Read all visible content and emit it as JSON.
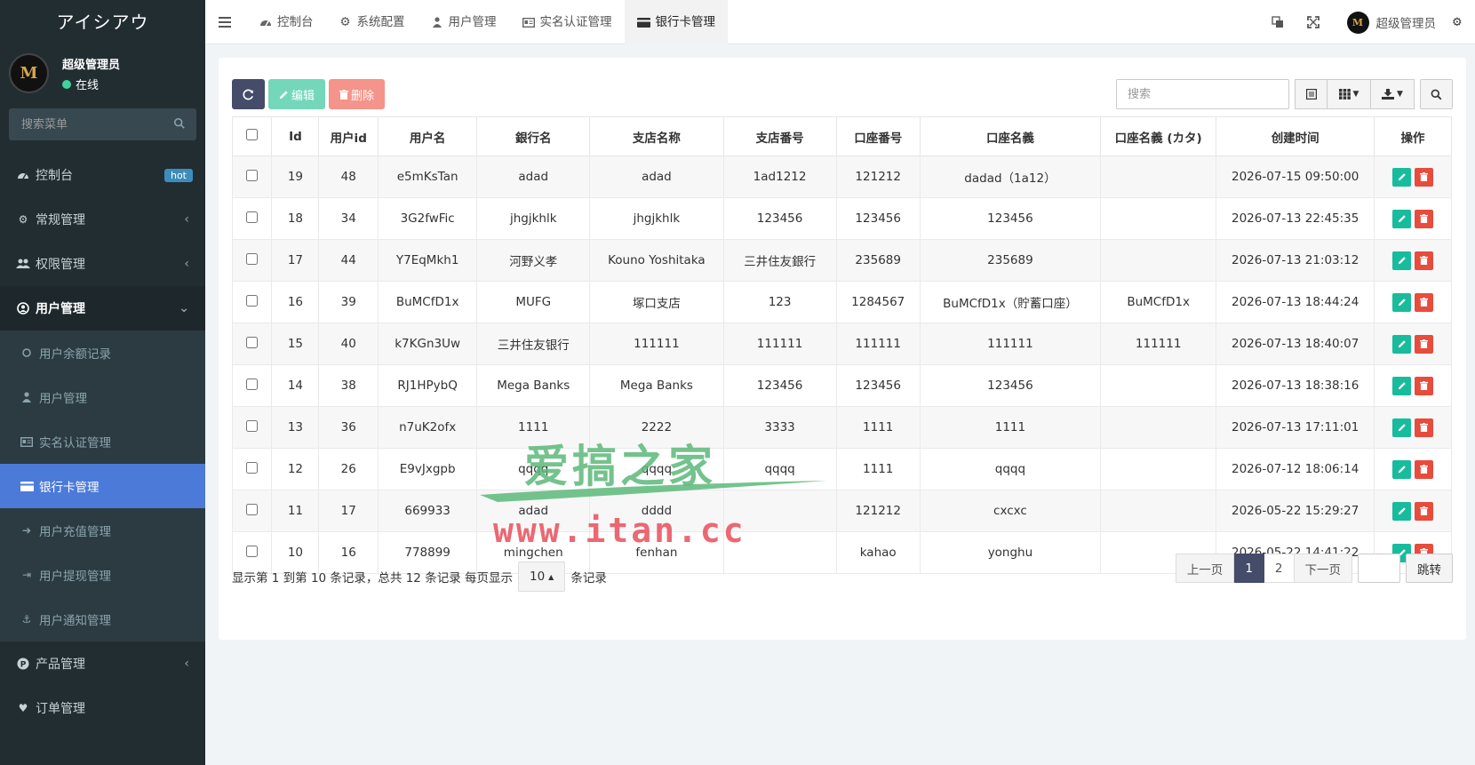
{
  "brand": "アイシアウ",
  "user": {
    "name": "超级管理员",
    "status": "在线",
    "avatar_letter": "M"
  },
  "menu_search_placeholder": "搜索菜单",
  "menu": {
    "dashboard": "控制台",
    "dashboard_badge": "hot",
    "general": "常规管理",
    "permission": "权限管理",
    "user_mgmt": "用户管理",
    "sub": {
      "balance": "用户余额记录",
      "users": "用户管理",
      "realname": "实名认证管理",
      "bankcard": "银行卡管理",
      "recharge": "用户充值管理",
      "withdraw": "用户提现管理",
      "notice": "用户通知管理"
    },
    "product": "产品管理",
    "order": "订单管理"
  },
  "tabs": [
    "控制台",
    "系统配置",
    "用户管理",
    "实名认证管理",
    "银行卡管理"
  ],
  "topbar_user": "超级管理员",
  "toolbar": {
    "edit": "编辑",
    "delete": "删除",
    "search_placeholder": "搜索"
  },
  "table": {
    "headers": [
      "Id",
      "用户id",
      "用户名",
      "銀行名",
      "支店名称",
      "支店番号",
      "口座番号",
      "口座名義",
      "口座名義 (カタ)",
      "创建时间",
      "操作"
    ],
    "rows": [
      [
        "19",
        "48",
        "e5mKsTan",
        "adad",
        "adad",
        "1ad1212",
        "121212",
        "dadad（1a12）",
        "",
        "2026-07-15 09:50:00"
      ],
      [
        "18",
        "34",
        "3G2fwFic",
        "jhgjkhlk",
        "jhgjkhlk",
        "123456",
        "123456",
        "123456",
        "",
        "2026-07-13 22:45:35"
      ],
      [
        "17",
        "44",
        "Y7EqMkh1",
        "河野义孝",
        "Kouno Yoshitaka",
        "三井住友銀行",
        "235689",
        "235689",
        "",
        "2026-07-13 21:03:12"
      ],
      [
        "16",
        "39",
        "BuMCfD1x",
        "MUFG",
        "塚口支店",
        "123",
        "1284567",
        "BuMCfD1x（貯蓄口座）",
        "BuMCfD1x",
        "2026-07-13 18:44:24"
      ],
      [
        "15",
        "40",
        "k7KGn3Uw",
        "三井住友银行",
        "111111",
        "111111",
        "111111",
        "111111",
        "111111",
        "2026-07-13 18:40:07"
      ],
      [
        "14",
        "38",
        "RJ1HPybQ",
        "Mega Banks",
        "Mega Banks",
        "123456",
        "123456",
        "123456",
        "",
        "2026-07-13 18:38:16"
      ],
      [
        "13",
        "36",
        "n7uK2ofx",
        "1111",
        "2222",
        "3333",
        "1111",
        "1111",
        "",
        "2026-07-13 17:11:01"
      ],
      [
        "12",
        "26",
        "E9vJxgpb",
        "qqqq",
        "qqqq",
        "qqqq",
        "1111",
        "qqqq",
        "",
        "2026-07-12 18:06:14"
      ],
      [
        "11",
        "17",
        "669933",
        "adad",
        "dddd",
        "",
        "121212",
        "cxcxc",
        "",
        "2026-05-22 15:29:27"
      ],
      [
        "10",
        "16",
        "778899",
        "mingchen",
        "fenhan",
        "",
        "kahao",
        "yonghu",
        "",
        "2026-05-22 14:41:22"
      ]
    ]
  },
  "footer": {
    "prefix": "显示第 1 到第 10 条记录，总共 12 条记录 每页显示",
    "page_size": "10",
    "suffix": "条记录"
  },
  "pager": {
    "prev": "上一页",
    "pages": [
      "1",
      "2"
    ],
    "next": "下一页",
    "jump": "跳转"
  },
  "watermark": {
    "top": "爱搞之家",
    "bottom": "www.itan.cc"
  },
  "colors": {
    "sidebar": "#222d32",
    "active_item": "#4c7ad9",
    "edit": "#18bc9c",
    "delete": "#e74c3c",
    "page_active": "#444c69"
  }
}
